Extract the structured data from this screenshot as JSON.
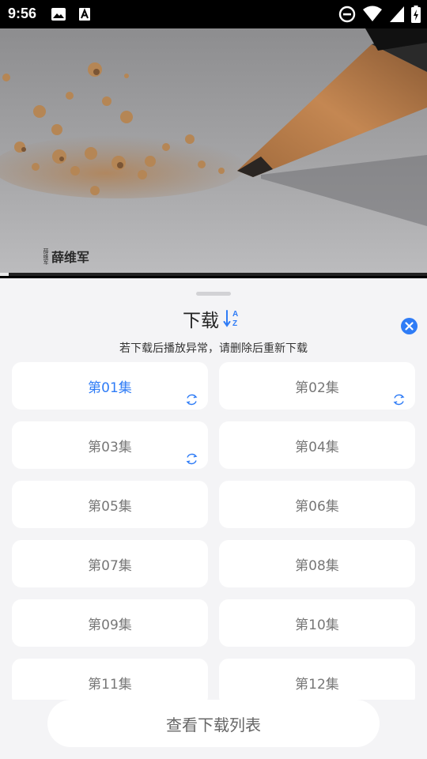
{
  "status_bar": {
    "time": "9:56",
    "left_icons": [
      "image-icon",
      "text-a-icon"
    ],
    "right_icons": [
      "do-not-disturb-icon",
      "wifi-icon",
      "signal-icon",
      "battery-icon"
    ]
  },
  "video": {
    "watermark_signature": "薛维军",
    "watermark_name": "薛维军",
    "progress": 0.02
  },
  "sheet": {
    "title": "下载",
    "sort_icon": "sort-a-z-icon",
    "close_icon": "close-icon",
    "hint": "若下载后播放异常，请删除后重新下载",
    "accent_color": "#2f7cf6",
    "episodes": [
      {
        "label": "第01集",
        "active": true,
        "downloading": true
      },
      {
        "label": "第02集",
        "active": false,
        "downloading": true
      },
      {
        "label": "第03集",
        "active": false,
        "downloading": true
      },
      {
        "label": "第04集",
        "active": false,
        "downloading": false
      },
      {
        "label": "第05集",
        "active": false,
        "downloading": false
      },
      {
        "label": "第06集",
        "active": false,
        "downloading": false
      },
      {
        "label": "第07集",
        "active": false,
        "downloading": false
      },
      {
        "label": "第08集",
        "active": false,
        "downloading": false
      },
      {
        "label": "第09集",
        "active": false,
        "downloading": false
      },
      {
        "label": "第10集",
        "active": false,
        "downloading": false
      },
      {
        "label": "第11集",
        "active": false,
        "downloading": false
      },
      {
        "label": "第12集",
        "active": false,
        "downloading": false
      }
    ],
    "view_list_button": "查看下载列表"
  }
}
